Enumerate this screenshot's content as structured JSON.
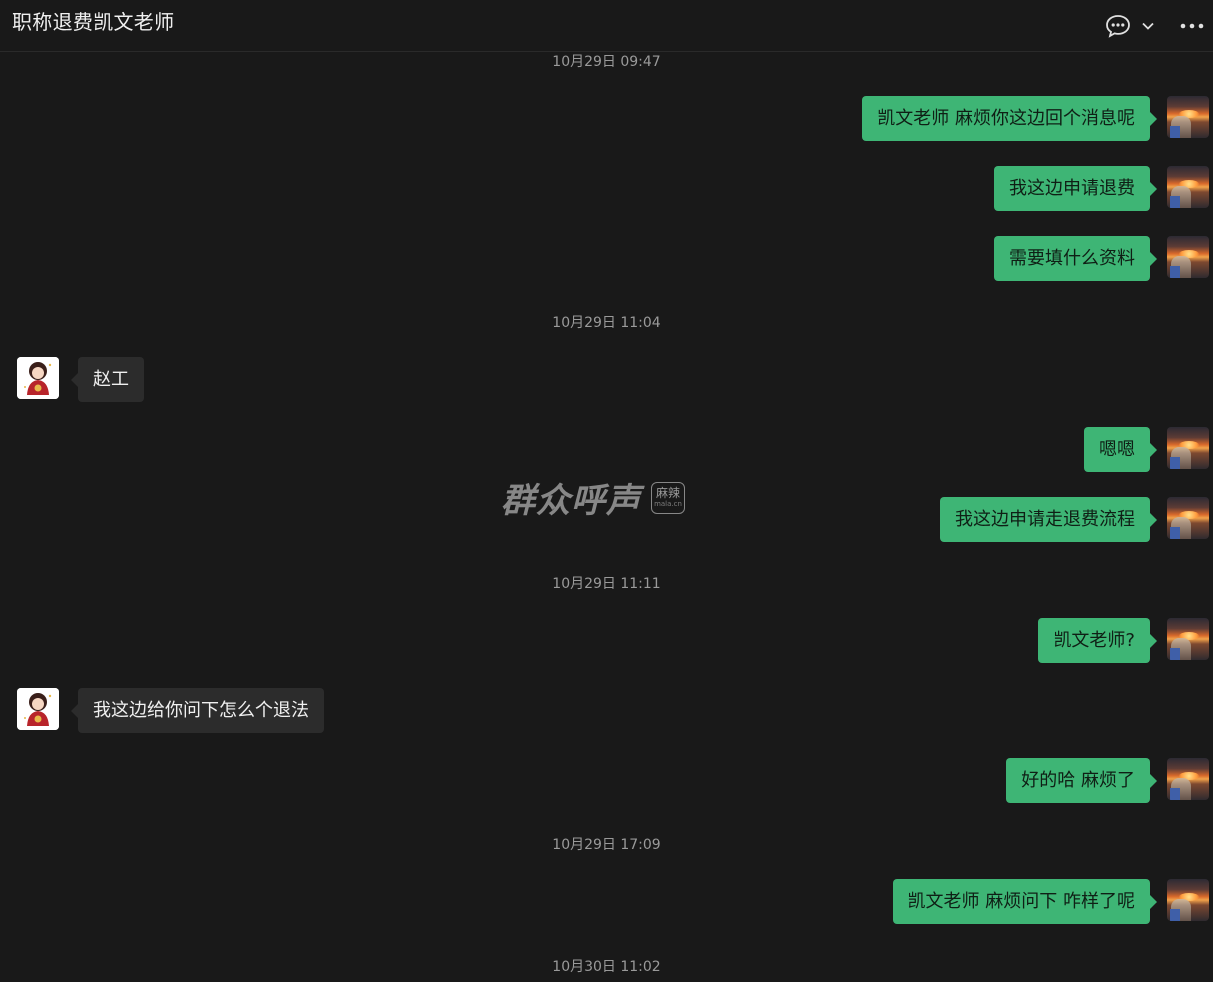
{
  "header": {
    "title": "职称退费凯文老师",
    "icons": [
      "chat-bubble-icon",
      "chevron-down-icon",
      "more-icon"
    ]
  },
  "colors": {
    "background": "#191919",
    "bubble_self": "#3eb575",
    "bubble_other": "#2c2c2c",
    "timestamp": "#9a9a9a"
  },
  "timestamps": [
    "10月29日 09:47",
    "10月29日 11:04",
    "10月29日 11:11",
    "10月29日 17:09",
    "10月30日 11:02"
  ],
  "messages": [
    {
      "side": "self",
      "text": "凯文老师 麻烦你这边回个消息呢"
    },
    {
      "side": "self",
      "text": "我这边申请退费"
    },
    {
      "side": "self",
      "text": "需要填什么资料"
    },
    {
      "side": "other",
      "text": "赵工"
    },
    {
      "side": "self",
      "text": "嗯嗯"
    },
    {
      "side": "self",
      "text": "我这边申请走退费流程"
    },
    {
      "side": "self",
      "text": "凯文老师?"
    },
    {
      "side": "other",
      "text": "我这边给你问下怎么个退法"
    },
    {
      "side": "self",
      "text": "好的哈 麻烦了"
    },
    {
      "side": "self",
      "text": "凯文老师 麻烦问下 咋样了呢"
    }
  ],
  "watermark": {
    "text": "群众呼声",
    "badge": "麻辣",
    "badge_sub": "mala.cn"
  }
}
